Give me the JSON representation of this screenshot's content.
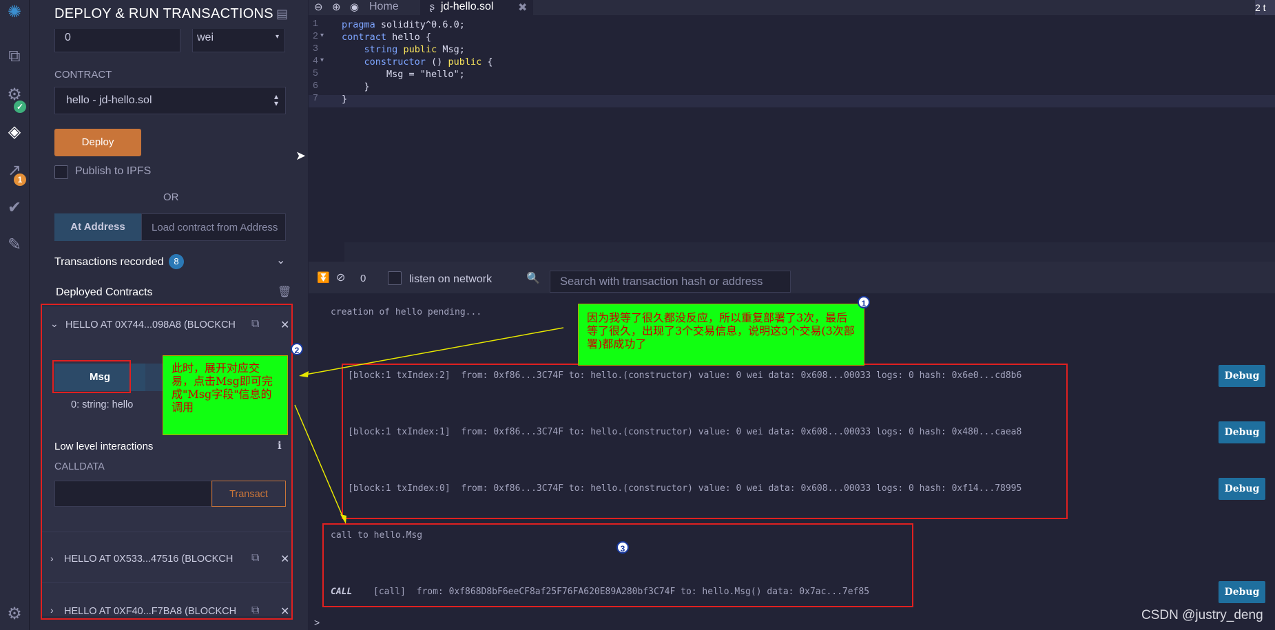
{
  "sidebar_panel": {
    "title": "DEPLOY & RUN TRANSACTIONS",
    "value_input": "0",
    "unit_select": "wei",
    "contract_label": "CONTRACT",
    "contract_select": "hello - jd-hello.sol",
    "deploy_label": "Deploy",
    "publish_label": "Publish to IPFS",
    "or_label": "OR",
    "at_address_label": "At Address",
    "at_address_placeholder": "Load contract from Address",
    "transactions_recorded_label": "Transactions recorded",
    "transactions_recorded_count": "8",
    "deployed_contracts_label": "Deployed Contracts",
    "instances": [
      {
        "label": "HELLO AT 0X744...098A8 (BLOCKCH"
      },
      {
        "label": "HELLO AT 0X533...47516 (BLOCKCH"
      },
      {
        "label": "HELLO AT 0XF40...F7BA8 (BLOCKCH"
      }
    ],
    "msg_button": "Msg",
    "msg_result": "0: string: hello",
    "low_level_label": "Low level interactions",
    "calldata_label": "CALLDATA",
    "transact_label": "Transact"
  },
  "rail": {
    "analysis_badge": "1"
  },
  "tabs": [
    {
      "label": "Home"
    },
    {
      "label": "jd-hello.sol"
    }
  ],
  "corner_badge": "2 t",
  "editor": {
    "line_numbers": [
      "1",
      "2",
      "3",
      "4",
      "5",
      "6",
      "7"
    ],
    "lines": [
      "pragma solidity^0.6.0;",
      "contract hello {",
      "    string public Msg;",
      "    constructor () public {",
      "        Msg = \"hello\";",
      "    }",
      "}"
    ]
  },
  "terminal": {
    "pending_count": "0",
    "listen_label": "listen on network",
    "search_placeholder": "Search with transaction hash or address",
    "pending_message": "creation of hello pending...",
    "transactions": [
      {
        "text": "[block:1 txIndex:2]  from: 0xf86...3C74F to: hello.(constructor) value: 0 wei data: 0x608...00033 logs: 0 hash: 0x6e0...cd8b6"
      },
      {
        "text": "[block:1 txIndex:1]  from: 0xf86...3C74F to: hello.(constructor) value: 0 wei data: 0x608...00033 logs: 0 hash: 0x480...caea8"
      },
      {
        "text": "[block:1 txIndex:0]  from: 0xf86...3C74F to: hello.(constructor) value: 0 wei data: 0x608...00033 logs: 0 hash: 0xf14...78995"
      }
    ],
    "debug_label": "Debug",
    "call_heading": "call to hello.Msg",
    "call_tag": "CALL",
    "call_text": "[call]  from: 0xf868D8bF6eeCF8af25F76FA620E89A280bf3C74F to: hello.Msg() data: 0x7ac...7ef85",
    "prompt": ">"
  },
  "annotations": {
    "note1": "因为我等了很久都没反应，所以重复部署了3次，最后等了很久，出现了3个交易信息，说明这3个交易(3次部署)都成功了",
    "note2": "此时，展开对应交易，点击Msg即可完成\"Msg字段\"信息的调用",
    "marker1": "1",
    "marker2": "2",
    "marker3": "3"
  },
  "watermark": "CSDN @justry_deng",
  "colors": {
    "accent_orange": "#c97539",
    "debug_blue": "#1f6f9e",
    "annotation_red": "#e02020",
    "note_green": "#11ff11"
  }
}
